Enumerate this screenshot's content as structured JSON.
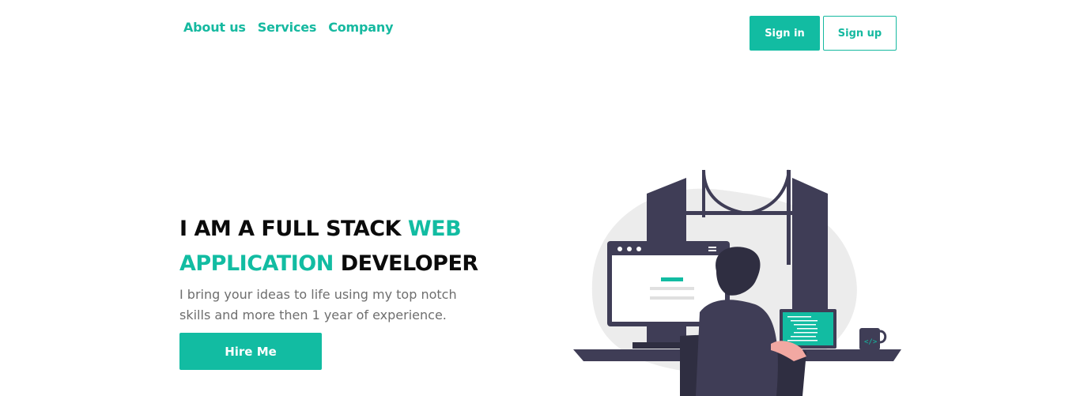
{
  "nav": {
    "items": [
      {
        "label": "About us"
      },
      {
        "label": "Services"
      },
      {
        "label": "Company"
      }
    ]
  },
  "auth": {
    "signin_label": "Sign in",
    "signup_label": "Sign up"
  },
  "hero": {
    "title_part1": "I AM A FULL STACK ",
    "title_accent1": "WEB",
    "title_accent2": "APPLICATION",
    "title_part2": " DEVELOPER",
    "subtitle": "I bring your ideas to life using my top notch skills and more then 1 year of experience.",
    "cta_label": "Hire Me"
  },
  "colors": {
    "accent": "#12bca2",
    "dark": "#3f3d56",
    "text_muted": "#6e6e6e"
  },
  "illustration": {
    "icon": "developer-at-desk-illustration"
  }
}
